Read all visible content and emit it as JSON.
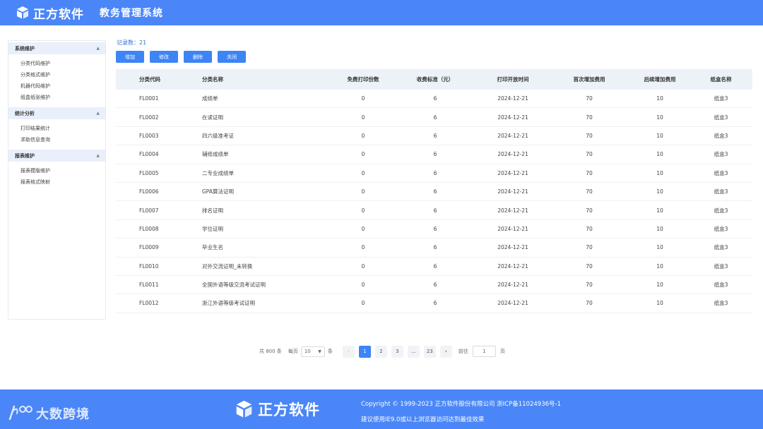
{
  "header": {
    "logo_text": "正方软件",
    "system_title": "教务管理系统"
  },
  "sidebar": {
    "groups": [
      {
        "title": "系统维护",
        "items": [
          "分类代码维护",
          "分类格式维护",
          "机器代码维护",
          "纸盒纸张维护"
        ]
      },
      {
        "title": "统计分析",
        "items": [
          "打印结果统计",
          "求助信息查询"
        ]
      },
      {
        "title": "报表维护",
        "items": [
          "报表模版维护",
          "报表格式映射"
        ]
      }
    ]
  },
  "main": {
    "record_count": "记录数：21",
    "buttons": {
      "add": "增加",
      "edit": "修改",
      "delete": "删除",
      "close": "关闭"
    },
    "table": {
      "headers": [
        "分类代码",
        "分类名称",
        "免费打印份数",
        "收费标准（元）",
        "打印开放时间",
        "首次增加费用",
        "后续增加费用",
        "纸盒名称"
      ],
      "rows": [
        [
          "FL0001",
          "成绩单",
          "0",
          "6",
          "2024-12-21",
          "70",
          "10",
          "纸盒3"
        ],
        [
          "FL0002",
          "在读证明",
          "0",
          "6",
          "2024-12-21",
          "70",
          "10",
          "纸盒3"
        ],
        [
          "FL0003",
          "四六级准考证",
          "0",
          "6",
          "2024-12-21",
          "70",
          "10",
          "纸盒3"
        ],
        [
          "FL0004",
          "辅修成绩单",
          "0",
          "6",
          "2024-12-21",
          "70",
          "10",
          "纸盒3"
        ],
        [
          "FL0005",
          "二专业成绩单",
          "0",
          "6",
          "2024-12-21",
          "70",
          "10",
          "纸盒3"
        ],
        [
          "FL0006",
          "GPA算法证明",
          "0",
          "6",
          "2024-12-21",
          "70",
          "10",
          "纸盒3"
        ],
        [
          "FL0007",
          "排名证明",
          "0",
          "6",
          "2024-12-21",
          "70",
          "10",
          "纸盒3"
        ],
        [
          "FL0008",
          "学位证明",
          "0",
          "6",
          "2024-12-21",
          "70",
          "10",
          "纸盒3"
        ],
        [
          "FL0009",
          "毕业生名",
          "0",
          "6",
          "2024-12-21",
          "70",
          "10",
          "纸盒3"
        ],
        [
          "FL0010",
          "对外交流证明_未转换",
          "0",
          "6",
          "2024-12-21",
          "70",
          "10",
          "纸盒3"
        ],
        [
          "FL0011",
          "全国外语等级交流考试证明",
          "0",
          "6",
          "2024-12-21",
          "70",
          "10",
          "纸盒3"
        ],
        [
          "FL0012",
          "浙江外语等级考试证明",
          "0",
          "6",
          "2024-12-21",
          "70",
          "10",
          "纸盒3"
        ]
      ]
    },
    "pagination": {
      "total": "共 800 条",
      "per_page_label": "每页",
      "per_page_value": "10",
      "per_page_unit": "条",
      "prev": "‹",
      "pages": [
        "1",
        "2",
        "3",
        "...",
        "23"
      ],
      "next": "›",
      "goto_label": "前往",
      "goto_value": "1",
      "goto_unit": "页"
    }
  },
  "footer": {
    "watermark_text": "大数跨境",
    "logo_text": "正方软件",
    "copyright": "Copyright © 1999-2023 正方软件股份有限公司 浙ICP备11024936号-1",
    "browser_tip": "建议使用IE9.0或以上浏览器访问达到最佳效果"
  },
  "colors": {
    "brand": "#4a86f7",
    "button": "#3d84f5",
    "table_header": "#edf2f9",
    "sidebar_group": "#e9f0fb"
  }
}
